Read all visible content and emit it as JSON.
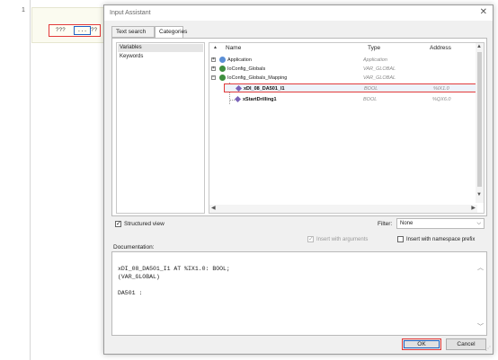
{
  "editor": {
    "line_number": "1",
    "contact_left": "???",
    "contact_dots": "...",
    "contact_right": "??"
  },
  "dialog": {
    "title": "Input Assistant",
    "close_glyph": "✕",
    "tabs": [
      {
        "label": "Text search"
      },
      {
        "label": "Categories"
      }
    ],
    "categories": [
      {
        "label": "Variables"
      },
      {
        "label": "Keywords"
      }
    ],
    "columns": {
      "name": "Name",
      "type": "Type",
      "address": "Address"
    },
    "tree": [
      {
        "name": "Application",
        "type": "Application",
        "address": "",
        "expander": "+"
      },
      {
        "name": "IoConfig_Globals",
        "type": "VAR_GLOBAL",
        "address": "",
        "expander": "+"
      },
      {
        "name": "IoConfig_Globals_Mapping",
        "type": "VAR_GLOBAL",
        "address": "",
        "expander": "−"
      },
      {
        "name": "xDI_08_DA501_I1",
        "type": "BOOL",
        "address": "%IX1.0"
      },
      {
        "name": "xStartDrilling1",
        "type": "BOOL",
        "address": "%QX6.0"
      }
    ],
    "structured_view_label": "Structured view",
    "filter_label": "Filter:",
    "filter_value": "None",
    "insert_with_arguments": "Insert with arguments",
    "insert_with_namespace_prefix": "Insert with namespace prefix",
    "documentation_label": "Documentation:",
    "documentation_lines": [
      "xDI_08_DA501_I1 AT %IX1.0: BOOL;",
      "(VAR_GLOBAL)",
      "",
      "DA501 :"
    ],
    "ok_label": "OK",
    "cancel_label": "Cancel"
  },
  "colors": {
    "highlight_border": "#e23a3a",
    "focus_blue": "#1f63c5",
    "icon_application": "#5b8fd6",
    "icon_globals": "#3f8f3f"
  }
}
